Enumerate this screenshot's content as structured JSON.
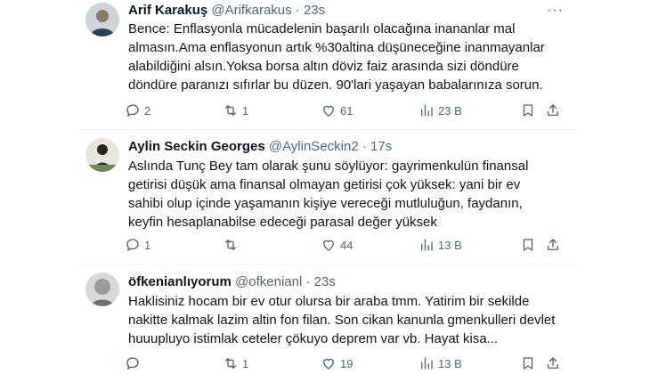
{
  "tweets": [
    {
      "name": "Arif Karakuş",
      "handle": "@Arifkarakus",
      "sep": "·",
      "time": "23s",
      "text": "Bence: Enflasyonla mücadelenin başarılı olacağına inananlar mal almasın.Ama enflasyonun artık %30altina düşüneceğine inanmayanlar alabildiğini alsın.Yoksa borsa altın döviz faiz arasında sizi döndüre döndüre paranızı sıfırlar bu düzen. 90'lari yaşayan babalarınıza sorun.",
      "replies": "2",
      "retweets": "1",
      "likes": "61",
      "views": "23 B"
    },
    {
      "name": "Aylin Seckin Georges",
      "handle": "@AylinSeckin2",
      "sep": "·",
      "time": "17s",
      "text": "Aslında Tunç Bey tam olarak şunu söylüyor: gayrimenkulün finansal getirisi düşük ama finansal olmayan getirisi çok yüksek: yani bir ev sahibi olup içinde yaşamanın kişiye vereceği mutluluğun, faydanın, keyfin hesaplanabilse edeceği parasal değer yüksek",
      "replies": "1",
      "retweets": "",
      "likes": "44",
      "views": "13 B"
    },
    {
      "name": "öfkenianlıyorum",
      "handle": "@ofkenianl",
      "sep": "·",
      "time": "23s",
      "text": "Haklisiniz hocam bir ev otur olursa bir araba tmm. Yatirim bir sekilde nakitte kalmak lazim altin fon filan. Son cikan kanunla gmenkulleri devlet huuupluyo istimlak ceteler çökuyo deprem var vb. Hayat kisa...",
      "replies": "",
      "retweets": "1",
      "likes": "19",
      "views": "13 B"
    }
  ],
  "more_label": "···"
}
